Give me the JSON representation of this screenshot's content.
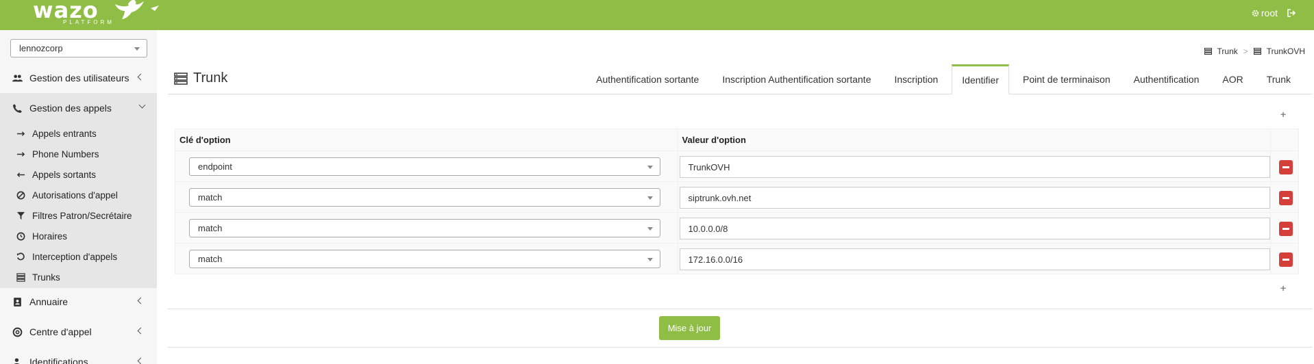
{
  "brand": {
    "logo_text": "wazo",
    "logo_sub": "PLATFORM",
    "accent_color": "#8fbd46"
  },
  "topbar": {
    "user": "root",
    "user_icon": "gear-icon",
    "logout_icon": "sign-out-icon"
  },
  "sidebar": {
    "tenant": "lennozcorp",
    "items": [
      {
        "label": "Gestion des utilisateurs",
        "icon": "users-icon"
      },
      {
        "label": "Gestion des appels",
        "icon": "phone-icon"
      },
      {
        "label": "Annuaire",
        "icon": "address-book-icon"
      },
      {
        "label": "Centre d'appel",
        "icon": "headset-icon"
      },
      {
        "label": "Identifications",
        "icon": "user-lock-icon"
      }
    ],
    "subitems": [
      {
        "label": "Appels entrants",
        "icon": "arrow-right-icon"
      },
      {
        "label": "Phone Numbers",
        "icon": "arrow-right-icon"
      },
      {
        "label": "Appels sortants",
        "icon": "arrow-left-icon"
      },
      {
        "label": "Autorisations d'appel",
        "icon": "ban-icon"
      },
      {
        "label": "Filtres Patron/Secrétaire",
        "icon": "filter-icon"
      },
      {
        "label": "Horaires",
        "icon": "clock-icon"
      },
      {
        "label": "Interception d'appels",
        "icon": "undo-icon"
      },
      {
        "label": "Trunks",
        "icon": "server-icon"
      }
    ]
  },
  "breadcrumb": {
    "items": [
      "Trunk",
      "TrunkOVH"
    ],
    "separator": ">"
  },
  "page_title": "Trunk",
  "tabs": [
    {
      "label": "Authentification sortante"
    },
    {
      "label": "Inscription Authentification sortante"
    },
    {
      "label": "Inscription"
    },
    {
      "label": "Identifier",
      "active": true
    },
    {
      "label": "Point de terminaison"
    },
    {
      "label": "Authentification"
    },
    {
      "label": "AOR"
    },
    {
      "label": "Trunk"
    }
  ],
  "table": {
    "headers": [
      "Clé d'option",
      "Valeur d'option"
    ],
    "rows": [
      {
        "key": "endpoint",
        "value": "TrunkOVH"
      },
      {
        "key": "match",
        "value": "siptrunk.ovh.net"
      },
      {
        "key": "match",
        "value": "10.0.0.0/8"
      },
      {
        "key": "match",
        "value": "172.16.0.0/16"
      }
    ]
  },
  "actions": {
    "plus": "+",
    "update": "Mise à jour"
  }
}
